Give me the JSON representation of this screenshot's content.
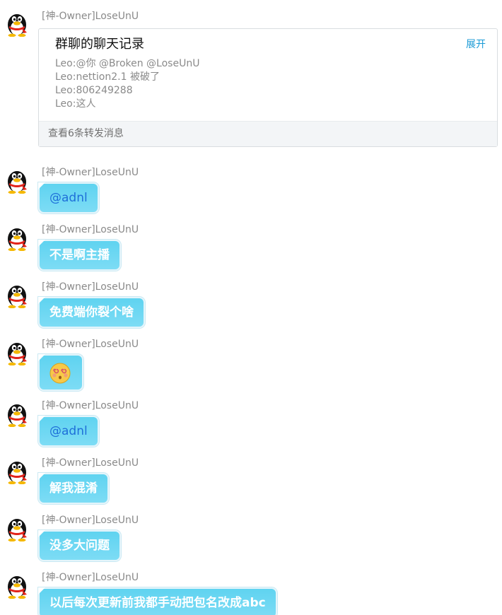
{
  "messages": [
    {
      "sender": "[神-Owner]LoseUnU",
      "type": "forward",
      "card": {
        "title": "群聊的聊天记录",
        "expand_label": "展开",
        "lines": [
          "Leo:@你 @Broken @LoseUnU",
          "Leo:nettion2.1 被破了",
          "Leo:806249288",
          "Leo:这人"
        ],
        "footer": "查看6条转发消息"
      }
    },
    {
      "sender": "[神-Owner]LoseUnU",
      "type": "mention",
      "text": "@adnl"
    },
    {
      "sender": "[神-Owner]LoseUnU",
      "type": "text",
      "text": "不是啊主播"
    },
    {
      "sender": "[神-Owner]LoseUnU",
      "type": "text",
      "text": "免费端你裂个啥"
    },
    {
      "sender": "[神-Owner]LoseUnU",
      "type": "emoji",
      "emoji": "dizzy-face-emoji"
    },
    {
      "sender": "[神-Owner]LoseUnU",
      "type": "mention",
      "text": "@adnl"
    },
    {
      "sender": "[神-Owner]LoseUnU",
      "type": "text",
      "text": "解我混淆"
    },
    {
      "sender": "[神-Owner]LoseUnU",
      "type": "text",
      "text": "没多大问题"
    },
    {
      "sender": "[神-Owner]LoseUnU",
      "type": "text",
      "text": "以后每次更新前我都手动把包名改成abc"
    }
  ],
  "avatar_icon": "qq-penguin-icon",
  "colors": {
    "bubble": "#5fd3f0",
    "mention_text": "#1e6fd9",
    "expand_link": "#1a9ad6"
  }
}
